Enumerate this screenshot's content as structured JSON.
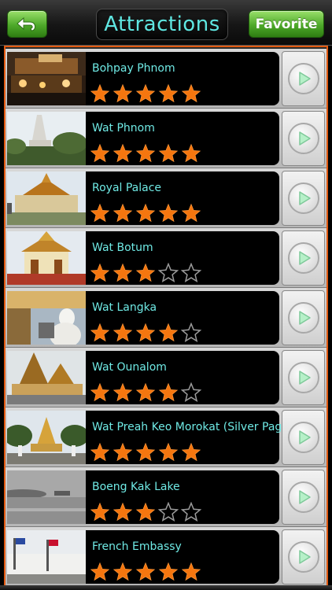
{
  "header": {
    "title": "Attractions",
    "favorite_label": "Favorite",
    "back_icon": "back-arrow-icon",
    "accent_title": "#5fe7e2",
    "button_green": "#4ea92a"
  },
  "list": {
    "border_color": "#e35a12",
    "star_color": "#f5760f",
    "items": [
      {
        "name": "Bohpay Phnom",
        "rating": 5,
        "thumb": "night-street-photo"
      },
      {
        "name": "Wat Phnom",
        "rating": 5,
        "thumb": "white-stupa-photo"
      },
      {
        "name": "Royal Palace",
        "rating": 5,
        "thumb": "palace-photo"
      },
      {
        "name": "Wat Botum",
        "rating": 3,
        "thumb": "temple-photo"
      },
      {
        "name": "Wat Langka",
        "rating": 4,
        "thumb": "buddha-statue-photo"
      },
      {
        "name": "Wat Ounalom",
        "rating": 4,
        "thumb": "pagoda-photo"
      },
      {
        "name": "Wat Preah Keo Morokat (Silver Pagoda)",
        "rating": 5,
        "thumb": "silver-pagoda-photo"
      },
      {
        "name": "Boeng Kak Lake",
        "rating": 3,
        "thumb": "lake-photo"
      },
      {
        "name": "French Embassy",
        "rating": 5,
        "thumb": "embassy-photo"
      }
    ]
  }
}
